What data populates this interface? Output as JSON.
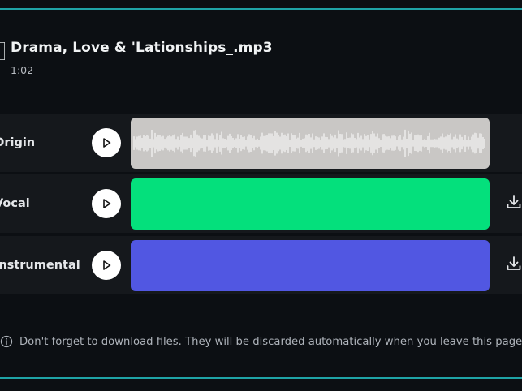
{
  "file": {
    "name": "Drama, Love & 'Lationships_.mp3",
    "duration": "1:02"
  },
  "tracks": [
    {
      "label": "Origin",
      "color": "#c9c7c5",
      "waveform": true,
      "downloadable": false
    },
    {
      "label": "Vocal",
      "color": "#04e07c",
      "waveform": false,
      "downloadable": true
    },
    {
      "label": "Instrumental",
      "color": "#5157e2",
      "waveform": false,
      "downloadable": true
    }
  ],
  "icons": {
    "play": "play-icon",
    "download": "download-icon",
    "info": "info-icon",
    "file": "file-icon"
  },
  "notice": "Don't forget to download files. They will be discarded automatically when you leave this page.",
  "colors": {
    "accent_line": "#1fa3a6",
    "background": "#0c0f13",
    "row_background": "#15181c"
  }
}
